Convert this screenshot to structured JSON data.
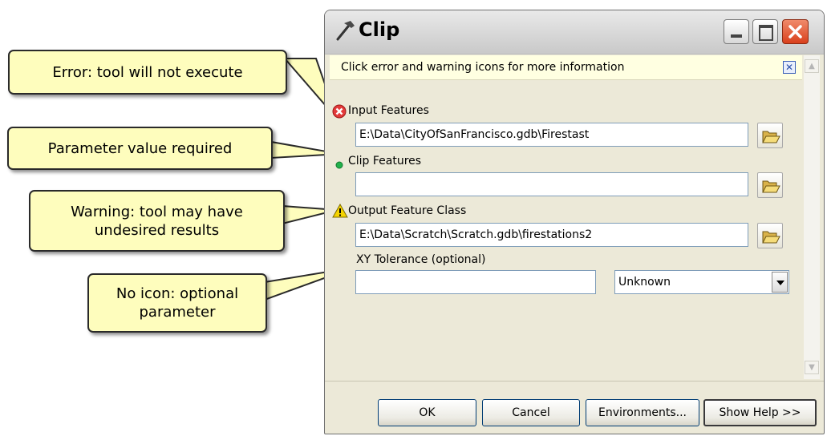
{
  "window": {
    "title": "Clip"
  },
  "infobar": {
    "message": "Click error and warning icons for more information",
    "close_glyph": "✕"
  },
  "parameters": {
    "input_features": {
      "label": "Input Features",
      "value": "E:\\Data\\CityOfSanFrancisco.gdb\\Firestast",
      "status": "error-icon"
    },
    "clip_features": {
      "label": "Clip Features",
      "value": "",
      "status": "required-dot-icon"
    },
    "output_feature_class": {
      "label": "Output Feature Class",
      "value": "E:\\Data\\Scratch\\Scratch.gdb\\firestations2",
      "status": "warning-icon"
    },
    "xy_tolerance": {
      "label": "XY Tolerance (optional)",
      "value": "",
      "unit": "Unknown"
    }
  },
  "buttons": {
    "ok": "OK",
    "cancel": "Cancel",
    "environments": "Environments...",
    "show_help": "Show Help >>"
  },
  "callouts": {
    "error": "Error: tool will not execute",
    "required": "Parameter value required",
    "warning": "Warning: tool may have undesired results",
    "optional": "No icon: optional parameter"
  },
  "colors": {
    "callout_fill": "#fefdbd",
    "dialog_bg": "#ece9d8",
    "infobar_bg": "#ffffe1",
    "error": "#e33a3a",
    "required": "#22b14c",
    "warning": "#f5d400"
  }
}
